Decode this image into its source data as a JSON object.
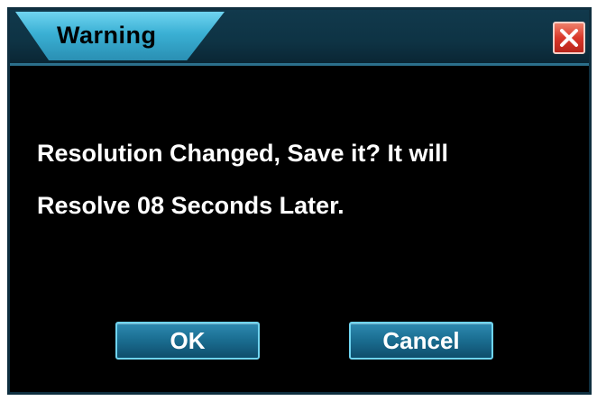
{
  "dialog": {
    "title": "Warning",
    "close_icon": "close-icon",
    "message_line1": "Resolution Changed, Save it? It will",
    "message_line2": "Resolve 08 Seconds Later.",
    "ok_label": "OK",
    "cancel_label": "Cancel"
  },
  "colors": {
    "background": "#000000",
    "title_tab": "#3ab0d4",
    "close_button": "#d9382a",
    "button": "#1b6f93"
  }
}
